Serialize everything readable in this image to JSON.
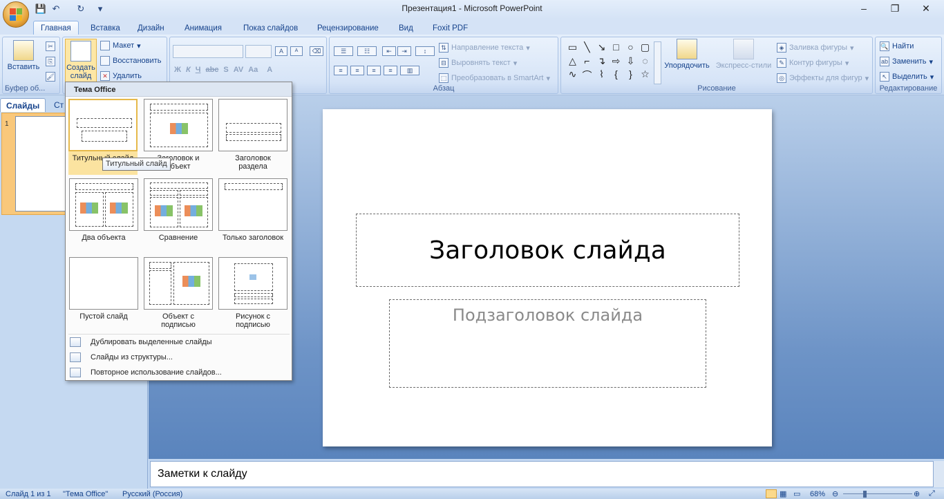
{
  "window": {
    "title": "Презентация1 - Microsoft PowerPoint",
    "minimize": "–",
    "maximize": "❐",
    "close": "✕"
  },
  "qat": {
    "save": "💾",
    "undo": "↶",
    "redo": "↻",
    "customize": "▾"
  },
  "tabs": [
    "Главная",
    "Вставка",
    "Дизайн",
    "Анимация",
    "Показ слайдов",
    "Рецензирование",
    "Вид",
    "Foxit PDF"
  ],
  "ribbon": {
    "clipboard": {
      "label": "Буфер об...",
      "paste": "Вставить"
    },
    "slides": {
      "new_slide": "Создать слайд",
      "layout": "Макет",
      "reset": "Восстановить",
      "delete": "Удалить"
    },
    "font": {
      "bold": "Ж",
      "italic": "К",
      "underline": "Ч",
      "strike": "abc",
      "shadow": "S",
      "spacing": "AV",
      "case": "Aa",
      "color": "A",
      "grow": "A",
      "shrink": "A"
    },
    "paragraph": {
      "label": "Абзац",
      "text_direction": "Направление текста",
      "align_text": "Выровнять текст",
      "smartart": "Преобразовать в SmartArt"
    },
    "drawing": {
      "label": "Рисование",
      "arrange": "Упорядочить",
      "quick_styles": "Экспресс-стили",
      "fill": "Заливка фигуры",
      "outline": "Контур фигуры",
      "effects": "Эффекты для фигур"
    },
    "editing": {
      "label": "Редактирование",
      "find": "Найти",
      "replace": "Заменить",
      "select": "Выделить"
    }
  },
  "pane": {
    "tab_slides": "Слайды",
    "tab_outline": "Ст",
    "slide_number": "1"
  },
  "slide": {
    "title": "Заголовок слайда",
    "subtitle": "Подзаголовок слайда"
  },
  "notes": "Заметки к слайду",
  "status": {
    "slide_info": "Слайд 1 из 1",
    "theme": "\"Тема Office\"",
    "language": "Русский (Россия)",
    "zoom": "68%"
  },
  "dropdown": {
    "header": "Тема Office",
    "layouts": [
      {
        "line1": "Титульный слайд",
        "line2": ""
      },
      {
        "line1": "Заголовок и",
        "line2": "объект"
      },
      {
        "line1": "Заголовок",
        "line2": "раздела"
      },
      {
        "line1": "Два объекта",
        "line2": ""
      },
      {
        "line1": "Сравнение",
        "line2": ""
      },
      {
        "line1": "Только заголовок",
        "line2": ""
      },
      {
        "line1": "Пустой слайд",
        "line2": ""
      },
      {
        "line1": "Объект с",
        "line2": "подписью"
      },
      {
        "line1": "Рисунок с",
        "line2": "подписью"
      }
    ],
    "menu": [
      "Дублировать выделенные слайды",
      "Слайды из структуры...",
      "Повторное использование слайдов..."
    ],
    "tooltip": "Титульный слайд"
  }
}
